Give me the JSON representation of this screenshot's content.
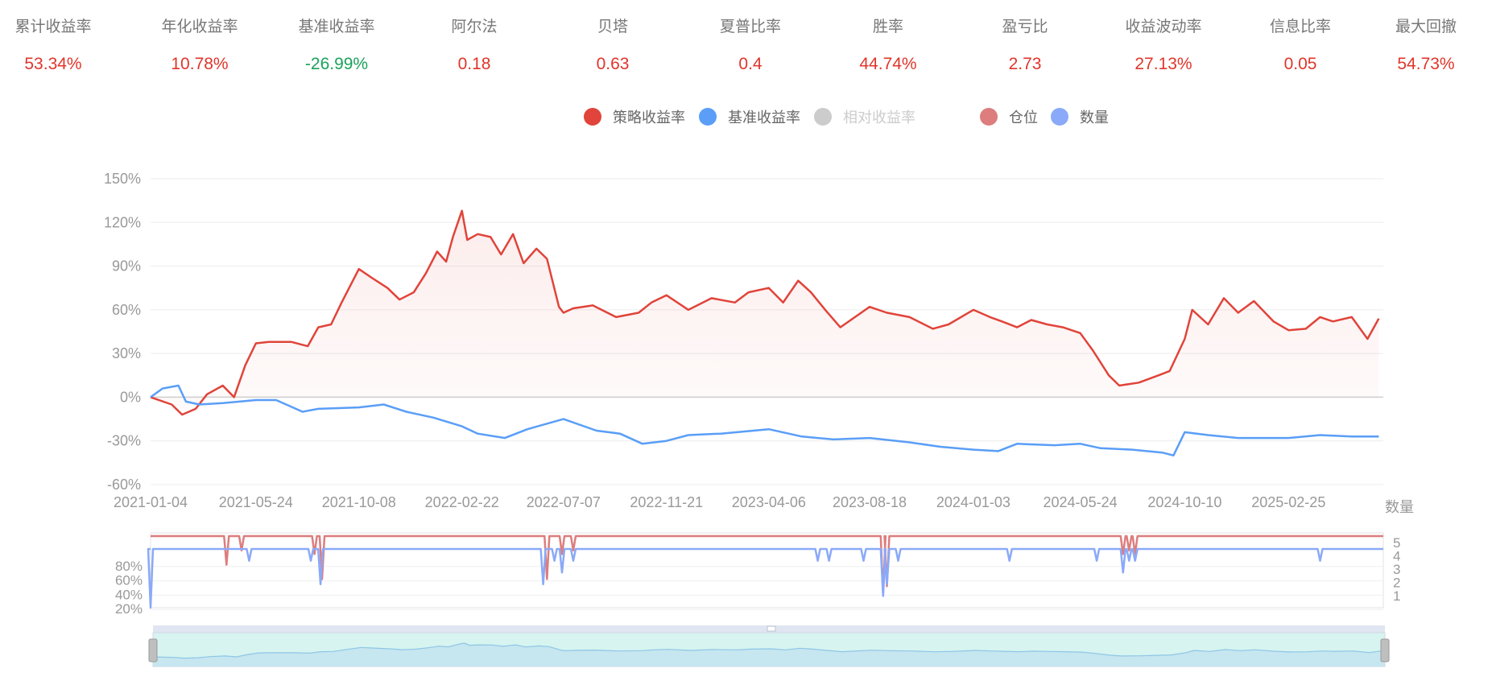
{
  "stats": [
    {
      "label": "累计收益率",
      "value": "53.34%",
      "color": "#e0352b"
    },
    {
      "label": "年化收益率",
      "value": "10.78%",
      "color": "#e0352b"
    },
    {
      "label": "基准收益率",
      "value": "-26.99%",
      "color": "#1aa35b"
    },
    {
      "label": "阿尔法",
      "value": "0.18",
      "color": "#e0352b"
    },
    {
      "label": "贝塔",
      "value": "0.63",
      "color": "#e0352b"
    },
    {
      "label": "夏普比率",
      "value": "0.4",
      "color": "#e0352b"
    },
    {
      "label": "胜率",
      "value": "44.74%",
      "color": "#e0352b"
    },
    {
      "label": "盈亏比",
      "value": "2.73",
      "color": "#e0352b"
    },
    {
      "label": "收益波动率",
      "value": "27.13%",
      "color": "#e0352b"
    },
    {
      "label": "信息比率",
      "value": "0.05",
      "color": "#e0352b"
    },
    {
      "label": "最大回撤",
      "value": "54.73%",
      "color": "#e0352b"
    }
  ],
  "legend": [
    {
      "label": "策略收益率",
      "color": "#e0443a",
      "active": true
    },
    {
      "label": "基准收益率",
      "color": "#5a9ef7",
      "active": true
    },
    {
      "label": "相对收益率",
      "color": "#cccccc",
      "active": false
    },
    {
      "label": "仓位",
      "color": "#dd7d7d",
      "active": true
    },
    {
      "label": "数量",
      "color": "#8aa9f8",
      "active": true
    }
  ],
  "chart_data": [
    {
      "type": "line",
      "x_tick_labels": [
        "2021-01-04",
        "2021-05-24",
        "2021-10-08",
        "2022-02-22",
        "2022-07-07",
        "2022-11-21",
        "2023-04-06",
        "2023-08-18",
        "2024-01-03",
        "2024-05-24",
        "2024-10-10",
        "2025-02-25"
      ],
      "y_tick_labels": [
        "150%",
        "120%",
        "90%",
        "60%",
        "30%",
        "0%",
        "-30%",
        "-60%"
      ],
      "ylim": [
        -60,
        150
      ],
      "x_range": [
        "2021-01-04",
        "2025-07"
      ],
      "grid": true,
      "series": [
        {
          "name": "策略收益率",
          "color": "#e0443a",
          "area": true,
          "x": [
            "2021-01-04",
            "2021-02-01",
            "2021-02-15",
            "2021-03-05",
            "2021-03-20",
            "2021-04-10",
            "2021-04-25",
            "2021-05-10",
            "2021-05-24",
            "2021-06-10",
            "2021-07-10",
            "2021-08-01",
            "2021-08-15",
            "2021-09-01",
            "2021-09-15",
            "2021-10-08",
            "2021-10-25",
            "2021-11-15",
            "2021-12-01",
            "2021-12-20",
            "2022-01-05",
            "2022-01-20",
            "2022-02-01",
            "2022-02-10",
            "2022-02-22",
            "2022-03-01",
            "2022-03-15",
            "2022-04-01",
            "2022-04-15",
            "2022-05-01",
            "2022-05-15",
            "2022-06-01",
            "2022-06-15",
            "2022-07-01",
            "2022-07-07",
            "2022-07-20",
            "2022-08-15",
            "2022-09-15",
            "2022-10-15",
            "2022-11-01",
            "2022-11-21",
            "2022-12-20",
            "2023-01-20",
            "2023-02-20",
            "2023-03-10",
            "2023-04-06",
            "2023-04-25",
            "2023-05-15",
            "2023-06-01",
            "2023-06-20",
            "2023-07-10",
            "2023-08-18",
            "2023-09-10",
            "2023-10-10",
            "2023-11-10",
            "2023-12-01",
            "2024-01-03",
            "2024-01-25",
            "2024-02-10",
            "2024-03-01",
            "2024-03-20",
            "2024-04-10",
            "2024-05-01",
            "2024-05-24",
            "2024-06-10",
            "2024-07-01",
            "2024-07-15",
            "2024-08-10",
            "2024-09-05",
            "2024-09-20",
            "2024-10-10",
            "2024-10-20",
            "2024-11-10",
            "2024-12-01",
            "2024-12-20",
            "2025-01-10",
            "2025-02-05",
            "2025-02-25",
            "2025-03-20",
            "2025-04-08",
            "2025-04-25",
            "2025-05-20",
            "2025-06-10",
            "2025-06-25"
          ],
          "values": [
            0,
            -5,
            -12,
            -8,
            2,
            8,
            0,
            22,
            37,
            38,
            38,
            35,
            48,
            50,
            65,
            88,
            82,
            75,
            67,
            72,
            85,
            100,
            93,
            110,
            128,
            108,
            112,
            110,
            98,
            112,
            92,
            102,
            95,
            62,
            58,
            61,
            63,
            55,
            58,
            65,
            70,
            60,
            68,
            65,
            72,
            75,
            65,
            80,
            72,
            60,
            48,
            62,
            58,
            55,
            47,
            50,
            60,
            55,
            52,
            48,
            53,
            50,
            48,
            44,
            32,
            15,
            8,
            10,
            15,
            18,
            40,
            60,
            50,
            68,
            58,
            66,
            52,
            46,
            47,
            55,
            52,
            55,
            40,
            54
          ]
        },
        {
          "name": "基准收益率",
          "color": "#5a9ef7",
          "area": false,
          "x": [
            "2021-01-04",
            "2021-01-20",
            "2021-02-10",
            "2021-02-20",
            "2021-03-10",
            "2021-04-10",
            "2021-05-24",
            "2021-06-20",
            "2021-07-25",
            "2021-08-15",
            "2021-10-08",
            "2021-11-10",
            "2021-12-10",
            "2022-01-15",
            "2022-02-22",
            "2022-03-15",
            "2022-04-20",
            "2022-05-20",
            "2022-07-07",
            "2022-08-20",
            "2022-09-20",
            "2022-10-20",
            "2022-11-21",
            "2022-12-20",
            "2023-02-01",
            "2023-04-06",
            "2023-05-20",
            "2023-07-01",
            "2023-08-18",
            "2023-10-10",
            "2023-11-20",
            "2024-01-03",
            "2024-02-05",
            "2024-03-01",
            "2024-04-20",
            "2024-05-24",
            "2024-06-20",
            "2024-08-01",
            "2024-09-10",
            "2024-09-25",
            "2024-10-10",
            "2024-11-10",
            "2024-12-20",
            "2025-02-25",
            "2025-04-08",
            "2025-05-20",
            "2025-06-25"
          ],
          "values": [
            0,
            6,
            8,
            -3,
            -5,
            -4,
            -2,
            -2,
            -10,
            -8,
            -7,
            -5,
            -10,
            -14,
            -20,
            -25,
            -28,
            -22,
            -15,
            -23,
            -25,
            -32,
            -30,
            -26,
            -25,
            -22,
            -27,
            -29,
            -28,
            -31,
            -34,
            -36,
            -37,
            -32,
            -33,
            -32,
            -35,
            -36,
            -38,
            -40,
            -24,
            -26,
            -28,
            -28,
            -26,
            -27,
            -27
          ]
        }
      ]
    },
    {
      "type": "line",
      "x_range": [
        "2021-01-04",
        "2025-07"
      ],
      "xlabel": "数量",
      "y_left_tick_labels": [
        "80%",
        "60%",
        "40%",
        "20%"
      ],
      "y_right_tick_labels": [
        "5",
        "4",
        "3",
        "2",
        "1"
      ],
      "series": [
        {
          "name": "仓位",
          "color": "#dd7d7d",
          "axis": "left",
          "baseline": 100,
          "dips": [
            [
              "2021-04-15",
              60
            ],
            [
              "2021-05-05",
              80
            ],
            [
              "2021-08-10",
              75
            ],
            [
              "2021-08-20",
              40
            ],
            [
              "2022-06-15",
              40
            ],
            [
              "2022-07-05",
              75
            ],
            [
              "2022-07-20",
              80
            ],
            [
              "2023-09-05",
              20
            ],
            [
              "2023-09-10",
              30
            ],
            [
              "2024-07-20",
              75
            ],
            [
              "2024-07-28",
              80
            ],
            [
              "2024-08-05",
              75
            ]
          ]
        },
        {
          "name": "数量",
          "color": "#8aa9f8",
          "axis": "right",
          "baseline": 5,
          "dips": [
            [
              "2021-01-04",
              0
            ],
            [
              "2021-05-15",
              4
            ],
            [
              "2021-08-05",
              4
            ],
            [
              "2021-08-18",
              2
            ],
            [
              "2022-06-10",
              2
            ],
            [
              "2022-06-25",
              4
            ],
            [
              "2022-07-05",
              3
            ],
            [
              "2022-07-20",
              4
            ],
            [
              "2023-06-10",
              4
            ],
            [
              "2023-06-25",
              4
            ],
            [
              "2023-08-10",
              4
            ],
            [
              "2023-09-05",
              1
            ],
            [
              "2023-09-10",
              2
            ],
            [
              "2023-09-25",
              4
            ],
            [
              "2024-02-20",
              4
            ],
            [
              "2024-06-15",
              4
            ],
            [
              "2024-07-20",
              3
            ],
            [
              "2024-07-28",
              4
            ],
            [
              "2024-08-05",
              4
            ],
            [
              "2025-04-08",
              4
            ]
          ]
        }
      ]
    }
  ]
}
